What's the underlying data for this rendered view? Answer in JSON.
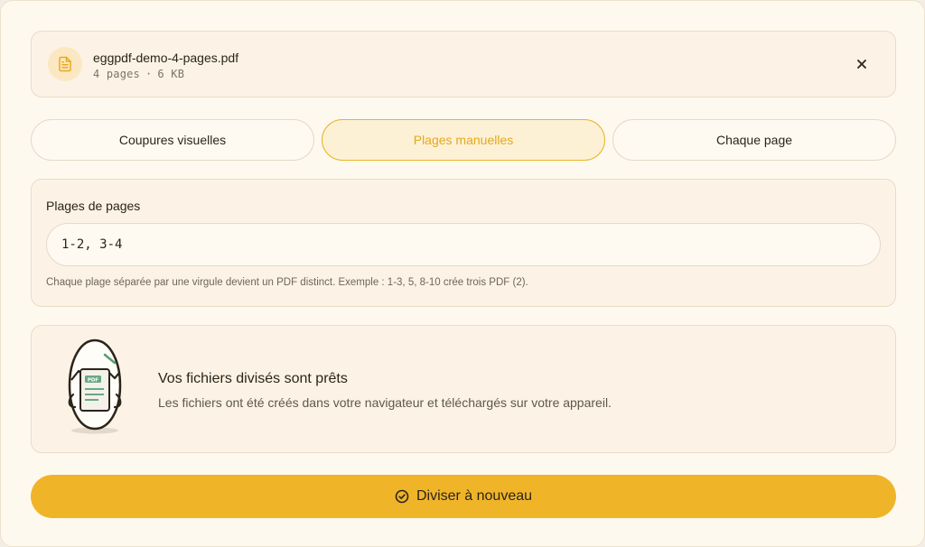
{
  "file": {
    "name": "eggpdf-demo-4-pages.pdf",
    "pages": "4 pages",
    "separator": "·",
    "size": "6 KB",
    "icon": "file-text-icon"
  },
  "tabs": [
    {
      "label": "Coupures visuelles",
      "active": false
    },
    {
      "label": "Plages manuelles",
      "active": true
    },
    {
      "label": "Chaque page",
      "active": false
    }
  ],
  "ranges": {
    "label": "Plages de pages",
    "value": "1-2, 3-4",
    "help": "Chaque plage séparée par une virgule devient un PDF distinct. Exemple : 1-3, 5, 8-10 crée trois PDF (2)."
  },
  "result": {
    "illustration_badge": "PDF",
    "title": "Vos fichiers divisés sont prêts",
    "subtitle": "Les fichiers ont été créés dans votre navigateur et téléchargés sur votre appareil."
  },
  "action": {
    "label": "Diviser à nouveau",
    "icon": "check-circle-icon"
  },
  "colors": {
    "accent": "#f0b429",
    "accent_text": "#e3a81e",
    "background": "#fef9ef"
  }
}
